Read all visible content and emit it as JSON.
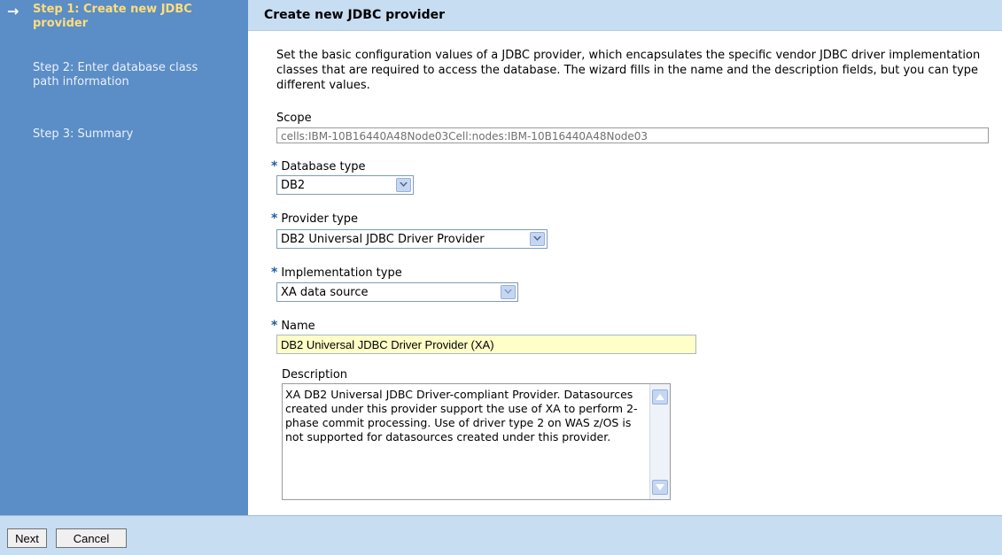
{
  "wizard": {
    "steps": [
      {
        "label": "Step 1: Create new JDBC provider",
        "current": true
      },
      {
        "label": "Step 2: Enter database class path information",
        "current": false
      },
      {
        "label": "Step 3: Summary",
        "current": false
      }
    ],
    "current_icon": "right-arrow-icon"
  },
  "page": {
    "title": "Create new JDBC provider",
    "intro": "Set the basic configuration values of a JDBC provider, which encapsulates the specific vendor JDBC driver implementation classes that are required to access the database. The wizard fills in the name and the description fields, but you can type different values."
  },
  "form": {
    "scope": {
      "label": "Scope",
      "value": "cells:IBM-10B16440A48Node03Cell:nodes:IBM-10B16440A48Node03"
    },
    "database_type": {
      "label": "Database type",
      "value": "DB2",
      "required": true
    },
    "provider_type": {
      "label": "Provider type",
      "value": "DB2 Universal JDBC Driver Provider",
      "required": true
    },
    "implementation_type": {
      "label": "Implementation type",
      "value": "XA data source",
      "required": true
    },
    "name": {
      "label": "Name",
      "value": "DB2 Universal JDBC Driver Provider (XA)",
      "required": true
    },
    "description": {
      "label": "Description",
      "value": "XA DB2 Universal JDBC Driver-compliant Provider. Datasources created under this provider support the use of XA to perform  2-phase commit processing. Use of driver type 2 on WAS z/OS is not supported for datasources created under this provider."
    },
    "required_marker": "*"
  },
  "footer": {
    "next_label": "Next",
    "cancel_label": "Cancel"
  },
  "colors": {
    "sidebar_bg": "#5b8dc7",
    "header_bg": "#c7ddf2",
    "current_step": "#ffde7a",
    "name_field_bg": "#ffffc8"
  }
}
